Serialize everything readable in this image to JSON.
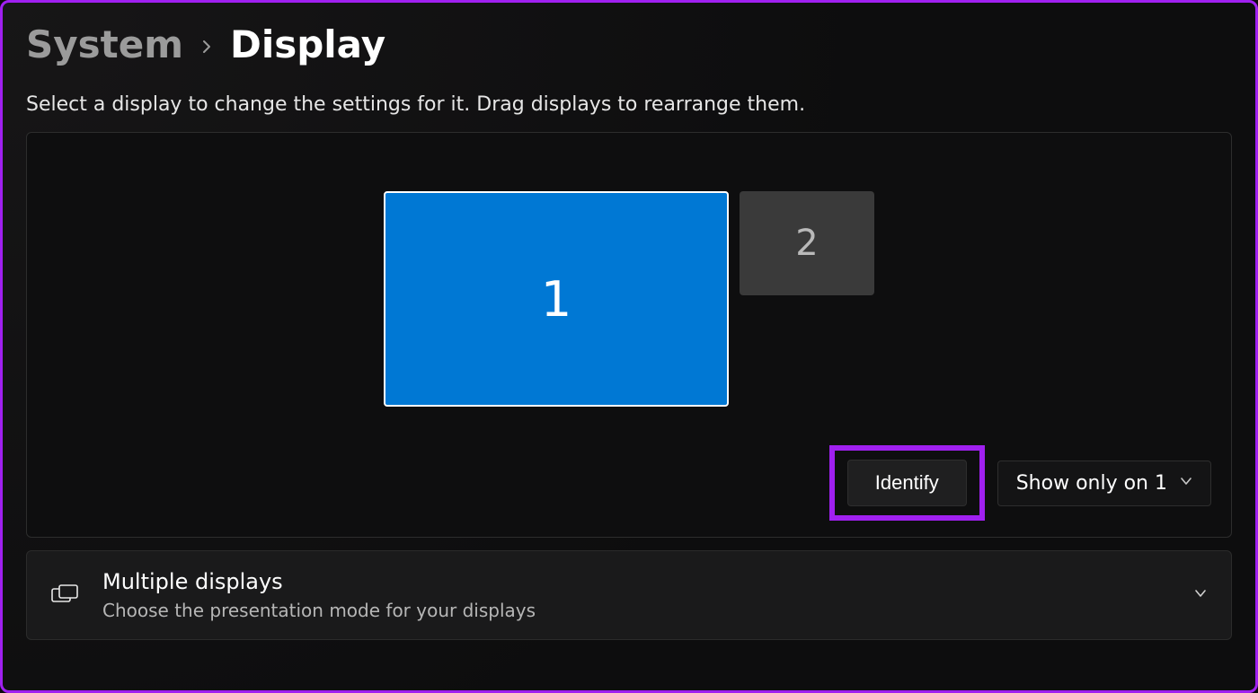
{
  "breadcrumb": {
    "parent": "System",
    "current": "Display"
  },
  "instruction": "Select a display to change the settings for it. Drag displays to rearrange them.",
  "displays": {
    "primary_label": "1",
    "secondary_label": "2"
  },
  "actions": {
    "identify_label": "Identify",
    "projection_selected": "Show only on 1"
  },
  "multiple_displays": {
    "title": "Multiple displays",
    "subtitle": "Choose the presentation mode for your displays"
  }
}
